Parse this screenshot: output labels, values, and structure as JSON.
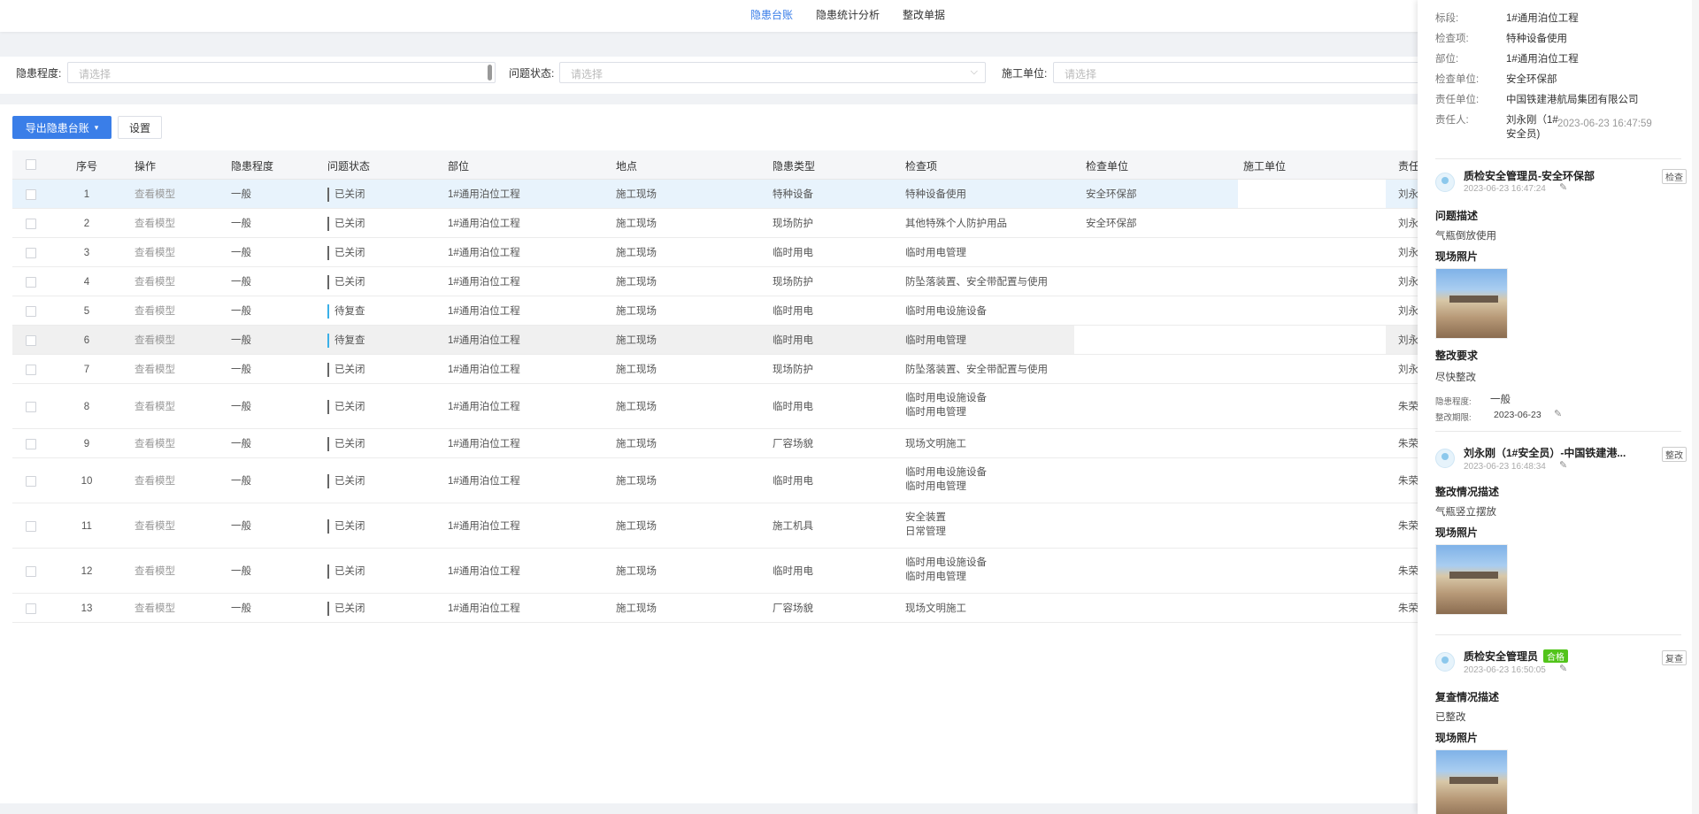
{
  "tabs": [
    "隐患台账",
    "隐患统计分析",
    "整改单据"
  ],
  "filters": {
    "level_label": "隐患程度:",
    "level_placeholder": "请选择",
    "status_label": "问题状态:",
    "status_placeholder": "请选择",
    "unit_label": "施工单位:",
    "unit_placeholder": "请选择"
  },
  "toolbar": {
    "export_label": "导出隐患台账",
    "settings_label": "设置"
  },
  "table": {
    "headers": [
      "序号",
      "操作",
      "隐患程度",
      "问题状态",
      "部位",
      "地点",
      "隐患类型",
      "检查项",
      "检查单位",
      "施工单位",
      "责任"
    ],
    "rows": [
      {
        "no": "1",
        "op": "查看模型",
        "level": "一般",
        "status": "已关闭",
        "part": "1#通用泊位工程",
        "place": "施工现场",
        "type": "特种设备",
        "item1": "特种设备使用",
        "item2": "",
        "unit": "安全环保部",
        "resp": "刘永"
      },
      {
        "no": "2",
        "op": "查看模型",
        "level": "一般",
        "status": "已关闭",
        "part": "1#通用泊位工程",
        "place": "施工现场",
        "type": "现场防护",
        "item1": "其他特殊个人防护用品",
        "item2": "",
        "unit": "安全环保部",
        "resp": "刘永"
      },
      {
        "no": "3",
        "op": "查看模型",
        "level": "一般",
        "status": "已关闭",
        "part": "1#通用泊位工程",
        "place": "施工现场",
        "type": "临时用电",
        "item1": "临时用电管理",
        "item2": "",
        "unit": "",
        "resp": "刘永"
      },
      {
        "no": "4",
        "op": "查看模型",
        "level": "一般",
        "status": "已关闭",
        "part": "1#通用泊位工程",
        "place": "施工现场",
        "type": "现场防护",
        "item1": "防坠落装置、安全带配置与使用",
        "item2": "",
        "unit": "",
        "resp": "刘永"
      },
      {
        "no": "5",
        "op": "查看模型",
        "level": "一般",
        "status": "待复查",
        "part": "1#通用泊位工程",
        "place": "施工现场",
        "type": "临时用电",
        "item1": "临时用电设施设备",
        "item2": "",
        "unit": "",
        "resp": "刘永"
      },
      {
        "no": "6",
        "op": "查看模型",
        "level": "一般",
        "status": "待复查",
        "part": "1#通用泊位工程",
        "place": "施工现场",
        "type": "临时用电",
        "item1": "临时用电管理",
        "item2": "",
        "unit": "",
        "resp": "刘永"
      },
      {
        "no": "7",
        "op": "查看模型",
        "level": "一般",
        "status": "已关闭",
        "part": "1#通用泊位工程",
        "place": "施工现场",
        "type": "现场防护",
        "item1": "防坠落装置、安全带配置与使用",
        "item2": "",
        "unit": "",
        "resp": "刘永"
      },
      {
        "no": "8",
        "op": "查看模型",
        "level": "一般",
        "status": "已关闭",
        "part": "1#通用泊位工程",
        "place": "施工现场",
        "type": "临时用电",
        "item1": "临时用电设施设备",
        "item2": "临时用电管理",
        "unit": "",
        "resp": "朱荣"
      },
      {
        "no": "9",
        "op": "查看模型",
        "level": "一般",
        "status": "已关闭",
        "part": "1#通用泊位工程",
        "place": "施工现场",
        "type": "厂容场貌",
        "item1": "现场文明施工",
        "item2": "",
        "unit": "",
        "resp": "朱荣"
      },
      {
        "no": "10",
        "op": "查看模型",
        "level": "一般",
        "status": "已关闭",
        "part": "1#通用泊位工程",
        "place": "施工现场",
        "type": "临时用电",
        "item1": "临时用电设施设备",
        "item2": "临时用电管理",
        "unit": "",
        "resp": "朱荣"
      },
      {
        "no": "11",
        "op": "查看模型",
        "level": "一般",
        "status": "已关闭",
        "part": "1#通用泊位工程",
        "place": "施工现场",
        "type": "施工机具",
        "item1": "安全装置",
        "item2": "日常管理",
        "unit": "",
        "resp": "朱荣"
      },
      {
        "no": "12",
        "op": "查看模型",
        "level": "一般",
        "status": "已关闭",
        "part": "1#通用泊位工程",
        "place": "施工现场",
        "type": "临时用电",
        "item1": "临时用电设施设备",
        "item2": "临时用电管理",
        "unit": "",
        "resp": "朱荣"
      },
      {
        "no": "13",
        "op": "查看模型",
        "level": "一般",
        "status": "已关闭",
        "part": "1#通用泊位工程",
        "place": "施工现场",
        "type": "厂容场貌",
        "item1": "现场文明施工",
        "item2": "",
        "unit": "",
        "resp": "朱荣"
      }
    ]
  },
  "panel": {
    "info": [
      {
        "k": "标段:",
        "v": "1#通用泊位工程"
      },
      {
        "k": "检查项:",
        "v": "特种设备使用"
      },
      {
        "k": "部位:",
        "v": "1#通用泊位工程"
      },
      {
        "k": "检查单位:",
        "v": "安全环保部"
      },
      {
        "k": "责任单位:",
        "v": "中国铁建港航局集团有限公司"
      }
    ],
    "resp_label": "责任人:",
    "resp_value1": "刘永刚（1#",
    "resp_value2": "安全员)",
    "resp_time": "2023-06-23 16:47:59",
    "record1": {
      "name": "质检安全管理员-安全环保部",
      "time": "2023-06-23 16:47:24",
      "tag": "检查",
      "desc_title": "问题描述",
      "desc": "气瓶倒放使用",
      "photo_title": "现场照片",
      "req_title": "整改要求",
      "req": "尽快整改",
      "level_label": "隐患程度:",
      "level_value": "一般",
      "deadline_label": "整改期限:",
      "deadline_value": "2023-06-23"
    },
    "record2": {
      "name": "刘永刚（1#安全员）-中国铁建港...",
      "time": "2023-06-23 16:48:34",
      "tag": "整改",
      "desc_title": "整改情况描述",
      "desc": "气瓶竖立摆放",
      "photo_title": "现场照片"
    },
    "record3": {
      "name": "质检安全管理员",
      "badge": "合格",
      "time": "2023-06-23 16:50:05",
      "tag": "复查",
      "desc_title": "复查情况描述",
      "desc": "已整改",
      "photo_title": "现场照片"
    }
  }
}
